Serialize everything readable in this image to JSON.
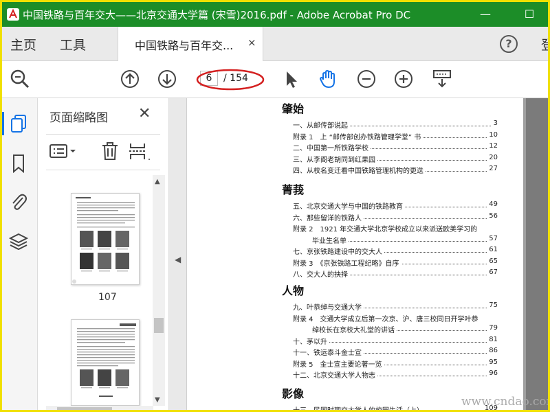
{
  "window": {
    "title": "中国铁路与百年交大——北京交通大学篇 (宋雪)2016.pdf - Adobe Acrobat Pro DC",
    "minimize_glyph": "—",
    "maximize_glyph": "☐"
  },
  "tabs": {
    "home": "主页",
    "tools": "工具",
    "document": "中国铁路与百年交...",
    "close_glyph": "×",
    "help_glyph": "?",
    "signin": "登"
  },
  "toolbar": {
    "current_page": "6",
    "total_pages": "/ 154",
    "highlight_color": "#d42020",
    "accent_color": "#1473e6",
    "icons": [
      "zoom-search-icon",
      "page-up-icon",
      "page-down-icon",
      "select-cursor-icon",
      "hand-tool-icon",
      "zoom-out-icon",
      "zoom-in-icon",
      "keyboard-scroll-icon"
    ]
  },
  "sidebar": {
    "panel_title": "页面缩略图",
    "close_glyph": "✕",
    "thumbnail_label": "107",
    "icons": [
      "page-thumbnails-icon",
      "bookmark-icon",
      "attachment-icon",
      "layers-icon"
    ]
  },
  "toc": {
    "sections": [
      {
        "title": "肇始",
        "entries": [
          {
            "text": "一、从邮传部说起",
            "page": "3"
          },
          {
            "text": "附录 1　上 “邮传部创办铁路管理学堂” 书",
            "page": "10"
          },
          {
            "text": "二、中国第一所铁路学校",
            "page": "12"
          },
          {
            "text": "三、从李阁老胡同到红果园",
            "page": "20"
          },
          {
            "text": "四、从校名变迁看中国铁路管理机构的更迭",
            "page": "27"
          }
        ]
      },
      {
        "title": "菁莪",
        "entries": [
          {
            "text": "五、北京交通大学与中国的铁路教育",
            "page": "49"
          },
          {
            "text": "六、那些留洋的铁路人",
            "page": "56"
          },
          {
            "text": "附录 2　1921 年交通大学北京学校成立以来派送欧美学习的",
            "page": ""
          },
          {
            "text": "毕业生名单",
            "page": "57",
            "cont": true
          },
          {
            "text": "七、京张铁路建设中的交大人",
            "page": "61"
          },
          {
            "text": "附录 3　《京张铁路工程纪略》自序",
            "page": "65"
          },
          {
            "text": "八、交大人的抉择",
            "page": "67"
          }
        ]
      },
      {
        "title": "人物",
        "entries": [
          {
            "text": "九、叶恭绰与交通大学",
            "page": "75"
          },
          {
            "text": "附录 4　交通大学成立后第一次京、沪、唐三校同日开学叶恭",
            "page": ""
          },
          {
            "text": "绰校长在京校大礼堂的讲话",
            "page": "79",
            "cont": true
          },
          {
            "text": "十、茅以升",
            "page": "81"
          },
          {
            "text": "十一、铁运泰斗金士宣",
            "page": "86"
          },
          {
            "text": "附录 5　金士宣主要论著一览",
            "page": "95"
          },
          {
            "text": "十二、北京交通大学人物志",
            "page": "96"
          }
        ]
      },
      {
        "title": "影像",
        "entries": [
          {
            "text": "十三、民国时期交大学人的校园生活（上）",
            "page": "109"
          }
        ]
      }
    ]
  },
  "watermark": "www.cndao.com"
}
